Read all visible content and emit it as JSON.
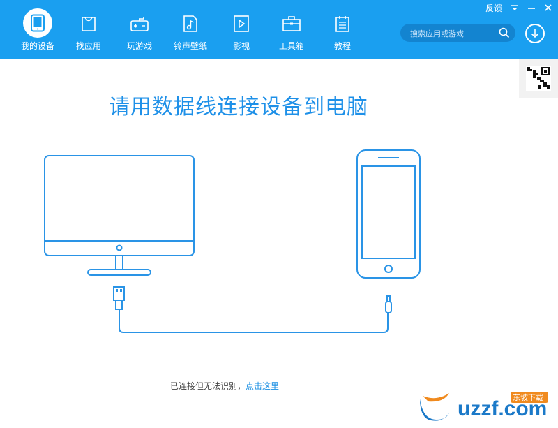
{
  "header": {
    "nav": [
      {
        "label": "我的设备",
        "icon": "tablet-icon",
        "active": true
      },
      {
        "label": "找应用",
        "icon": "shopping-bag-icon",
        "active": false
      },
      {
        "label": "玩游戏",
        "icon": "gamepad-icon",
        "active": false
      },
      {
        "label": "铃声壁纸",
        "icon": "music-note-icon",
        "active": false
      },
      {
        "label": "影视",
        "icon": "play-icon",
        "active": false
      },
      {
        "label": "工具箱",
        "icon": "toolbox-icon",
        "active": false
      },
      {
        "label": "教程",
        "icon": "document-icon",
        "active": false
      }
    ],
    "feedback_label": "反馈",
    "search": {
      "placeholder": "搜索应用或游戏"
    }
  },
  "main": {
    "title": "请用数据线连接设备到电脑",
    "status_text": "已连接但无法识别，",
    "status_link": "点击这里"
  },
  "watermark": {
    "text": "uzzf.com",
    "subtext": "东坡下载"
  },
  "colors": {
    "brand": "#1a9ff0",
    "line": "#2a94e6"
  }
}
